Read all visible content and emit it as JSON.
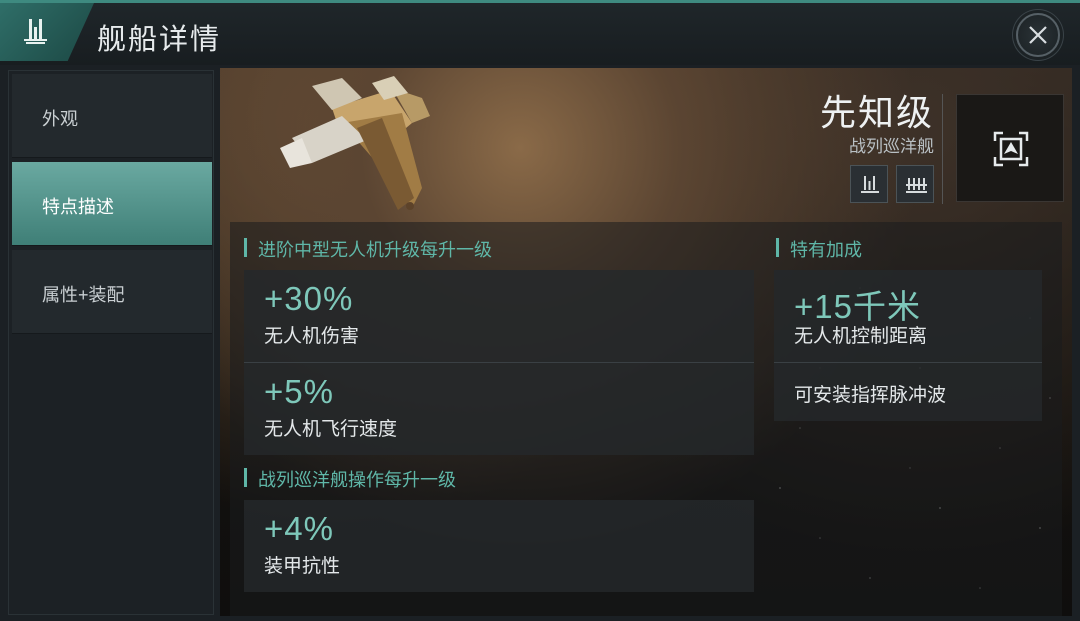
{
  "header": {
    "title": "舰船详情",
    "logo_icon": "ship-class-icon",
    "close_icon": "close-icon"
  },
  "sidebar": {
    "items": [
      {
        "label": "外观",
        "active": false
      },
      {
        "label": "特点描述",
        "active": true
      },
      {
        "label": "属性+装配",
        "active": false
      }
    ]
  },
  "ship": {
    "name": "先知级",
    "class": "战列巡洋舰",
    "role_icons": [
      "battlecruiser-icon",
      "drone-icon"
    ],
    "emblem_icon": "faction-emblem-icon"
  },
  "traits": {
    "skill_bonus_1": {
      "title": "进阶中型无人机升级每升一级",
      "items": [
        {
          "value": "+30%",
          "desc": "无人机伤害"
        },
        {
          "value": "+5%",
          "desc": "无人机飞行速度"
        }
      ]
    },
    "skill_bonus_2": {
      "title": "战列巡洋舰操作每升一级",
      "items": [
        {
          "value": "+4%",
          "desc": "装甲抗性"
        }
      ]
    },
    "role_bonus": {
      "title": "特有加成",
      "items": [
        {
          "value": "+15千米",
          "desc": "无人机控制距离"
        },
        {
          "text": "可安装指挥脉冲波"
        }
      ]
    }
  },
  "colors": {
    "accent": "#5fb7a8",
    "value_text": "#7ec8ba",
    "active_tab": "#5a9b93"
  }
}
